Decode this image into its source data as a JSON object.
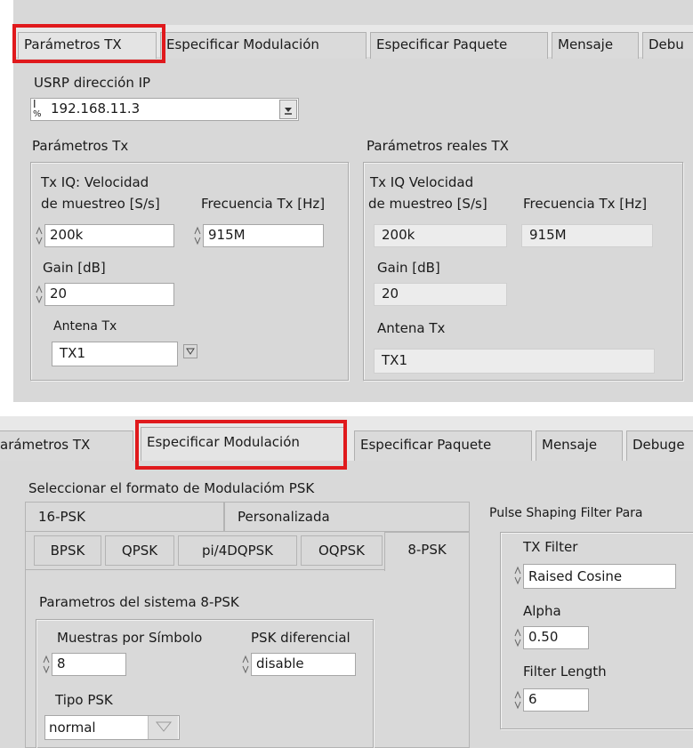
{
  "top": {
    "tabs": [
      "Parámetros TX",
      "Especificar Modulación",
      "Especificar Paquete",
      "Mensaje",
      "Debu"
    ],
    "ip": {
      "label": "USRP dirección IP",
      "value": "192.168.11.3"
    },
    "params": {
      "title": "Parámetros Tx",
      "rate_label_1": "Tx IQ: Velocidad",
      "rate_label_2": "de muestreo [S/s]",
      "rate_value": "200k",
      "freq_label": "Frecuencia Tx [Hz]",
      "freq_value": "915M",
      "gain_label": "Gain [dB]",
      "gain_value": "20",
      "antenna_label": "Antena Tx",
      "antenna_value": "TX1"
    },
    "real": {
      "title": "Parámetros reales TX",
      "rate_label_1": "Tx IQ Velocidad",
      "rate_label_2": "de muestreo [S/s]",
      "rate_value": "200k",
      "freq_label": "Frecuencia Tx [Hz]",
      "freq_value": "915M",
      "gain_label": "Gain [dB]",
      "gain_value": "20",
      "antenna_label": "Antena Tx",
      "antenna_value": "TX1"
    }
  },
  "bottom": {
    "tabs": [
      "arámetros TX",
      "Especificar Modulación",
      "Especificar Paquete",
      "Mensaje",
      "Debuge"
    ],
    "format_label": "Seleccionar el formato de Modulacióm PSK",
    "psk_tabs_row1": [
      "16-PSK",
      "Personalizada"
    ],
    "psk_tabs_row2": [
      "BPSK",
      "QPSK",
      "pi/4DQPSK",
      "OQPSK",
      "8-PSK"
    ],
    "system": {
      "title": "Parametros del sistema 8-PSK",
      "samples_label": "Muestras por Símbolo",
      "samples_value": "8",
      "diff_label": "PSK diferencial",
      "diff_value": "disable",
      "type_label": "Tipo PSK",
      "type_value": "normal"
    },
    "pulse": {
      "title": "Pulse Shaping Filter Para",
      "filter_label": "TX Filter",
      "filter_value": "Raised Cosine",
      "alpha_label": "Alpha",
      "alpha_value": "0.50",
      "length_label": "Filter Length",
      "length_value": "6"
    }
  },
  "colors": {
    "panel": "#d9d9d9",
    "highlight": "#e0191c",
    "field": "#ffffff",
    "readonly": "#ececec"
  }
}
